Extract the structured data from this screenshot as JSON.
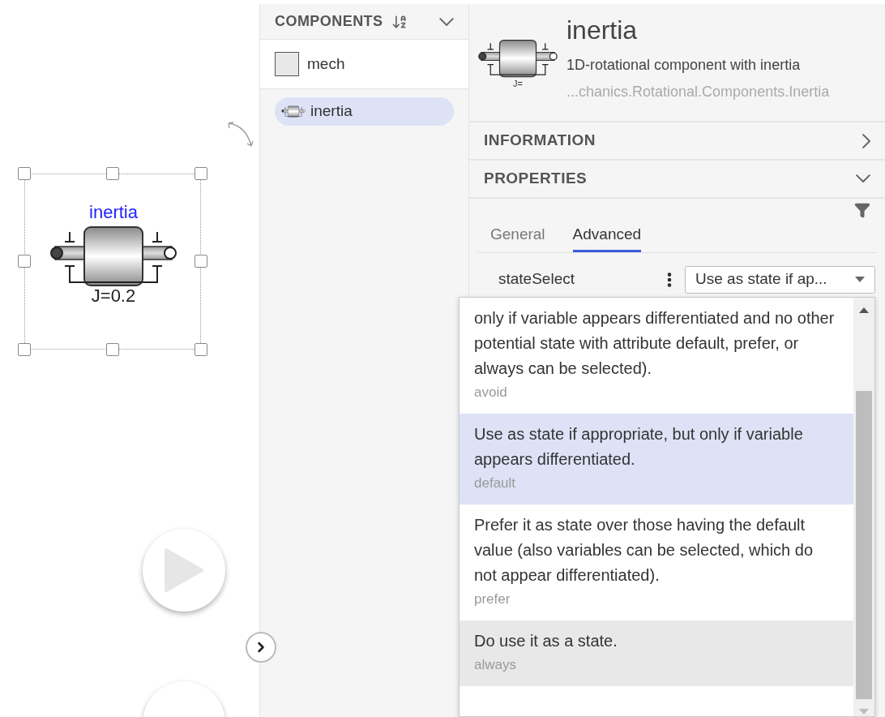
{
  "canvas": {
    "component": {
      "label": "inertia",
      "parameter": "J=0.2",
      "selected": true
    }
  },
  "components_panel": {
    "title": "COMPONENTS",
    "items": [
      {
        "label": "mech",
        "kind": "package",
        "selected": false
      },
      {
        "label": "inertia",
        "kind": "component",
        "selected": true
      }
    ]
  },
  "details": {
    "title": "inertia",
    "description": "1D-rotational component with inertia",
    "path": "...chanics.Rotational.Components.Inertia",
    "icon_label": "J="
  },
  "sections": [
    {
      "title": "INFORMATION",
      "expanded": false
    },
    {
      "title": "PROPERTIES",
      "expanded": true
    }
  ],
  "tabs": [
    {
      "label": "General",
      "selected": false
    },
    {
      "label": "Advanced",
      "selected": true
    }
  ],
  "parameter": {
    "name": "stateSelect",
    "value": "Use as state if ap..."
  },
  "dropdown_options": [
    {
      "text": "only if variable appears differentiated and no other potential state with attribute default, prefer, or always can be selected).",
      "value": "avoid",
      "selected": false,
      "hovered": false
    },
    {
      "text": "Use as state if appropriate, but only if variable appears differentiated.",
      "value": "default",
      "selected": true,
      "hovered": false
    },
    {
      "text": "Prefer it as state over those having the default value (also variables can be selected, which do not appear differentiated).",
      "value": "prefer",
      "selected": false,
      "hovered": false
    },
    {
      "text": "Do use it as a state.",
      "value": "always",
      "selected": false,
      "hovered": true
    }
  ]
}
